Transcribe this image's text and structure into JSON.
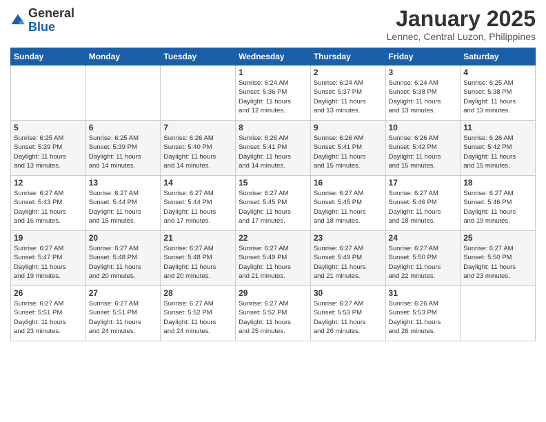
{
  "logo": {
    "general": "General",
    "blue": "Blue"
  },
  "title": "January 2025",
  "location": "Lennec, Central Luzon, Philippines",
  "days_header": [
    "Sunday",
    "Monday",
    "Tuesday",
    "Wednesday",
    "Thursday",
    "Friday",
    "Saturday"
  ],
  "weeks": [
    [
      {
        "day": "",
        "info": ""
      },
      {
        "day": "",
        "info": ""
      },
      {
        "day": "",
        "info": ""
      },
      {
        "day": "1",
        "info": "Sunrise: 6:24 AM\nSunset: 5:36 PM\nDaylight: 11 hours\nand 12 minutes."
      },
      {
        "day": "2",
        "info": "Sunrise: 6:24 AM\nSunset: 5:37 PM\nDaylight: 11 hours\nand 13 minutes."
      },
      {
        "day": "3",
        "info": "Sunrise: 6:24 AM\nSunset: 5:38 PM\nDaylight: 11 hours\nand 13 minutes."
      },
      {
        "day": "4",
        "info": "Sunrise: 6:25 AM\nSunset: 5:38 PM\nDaylight: 11 hours\nand 13 minutes."
      }
    ],
    [
      {
        "day": "5",
        "info": "Sunrise: 6:25 AM\nSunset: 5:39 PM\nDaylight: 11 hours\nand 13 minutes."
      },
      {
        "day": "6",
        "info": "Sunrise: 6:25 AM\nSunset: 5:39 PM\nDaylight: 11 hours\nand 14 minutes."
      },
      {
        "day": "7",
        "info": "Sunrise: 6:26 AM\nSunset: 5:40 PM\nDaylight: 11 hours\nand 14 minutes."
      },
      {
        "day": "8",
        "info": "Sunrise: 6:26 AM\nSunset: 5:41 PM\nDaylight: 11 hours\nand 14 minutes."
      },
      {
        "day": "9",
        "info": "Sunrise: 6:26 AM\nSunset: 5:41 PM\nDaylight: 11 hours\nand 15 minutes."
      },
      {
        "day": "10",
        "info": "Sunrise: 6:26 AM\nSunset: 5:42 PM\nDaylight: 11 hours\nand 15 minutes."
      },
      {
        "day": "11",
        "info": "Sunrise: 6:26 AM\nSunset: 5:42 PM\nDaylight: 11 hours\nand 15 minutes."
      }
    ],
    [
      {
        "day": "12",
        "info": "Sunrise: 6:27 AM\nSunset: 5:43 PM\nDaylight: 11 hours\nand 16 minutes."
      },
      {
        "day": "13",
        "info": "Sunrise: 6:27 AM\nSunset: 5:44 PM\nDaylight: 11 hours\nand 16 minutes."
      },
      {
        "day": "14",
        "info": "Sunrise: 6:27 AM\nSunset: 5:44 PM\nDaylight: 11 hours\nand 17 minutes."
      },
      {
        "day": "15",
        "info": "Sunrise: 6:27 AM\nSunset: 5:45 PM\nDaylight: 11 hours\nand 17 minutes."
      },
      {
        "day": "16",
        "info": "Sunrise: 6:27 AM\nSunset: 5:45 PM\nDaylight: 11 hours\nand 18 minutes."
      },
      {
        "day": "17",
        "info": "Sunrise: 6:27 AM\nSunset: 5:46 PM\nDaylight: 11 hours\nand 18 minutes."
      },
      {
        "day": "18",
        "info": "Sunrise: 6:27 AM\nSunset: 5:46 PM\nDaylight: 11 hours\nand 19 minutes."
      }
    ],
    [
      {
        "day": "19",
        "info": "Sunrise: 6:27 AM\nSunset: 5:47 PM\nDaylight: 11 hours\nand 19 minutes."
      },
      {
        "day": "20",
        "info": "Sunrise: 6:27 AM\nSunset: 5:48 PM\nDaylight: 11 hours\nand 20 minutes."
      },
      {
        "day": "21",
        "info": "Sunrise: 6:27 AM\nSunset: 5:48 PM\nDaylight: 11 hours\nand 20 minutes."
      },
      {
        "day": "22",
        "info": "Sunrise: 6:27 AM\nSunset: 5:49 PM\nDaylight: 11 hours\nand 21 minutes."
      },
      {
        "day": "23",
        "info": "Sunrise: 6:27 AM\nSunset: 5:49 PM\nDaylight: 11 hours\nand 21 minutes."
      },
      {
        "day": "24",
        "info": "Sunrise: 6:27 AM\nSunset: 5:50 PM\nDaylight: 11 hours\nand 22 minutes."
      },
      {
        "day": "25",
        "info": "Sunrise: 6:27 AM\nSunset: 5:50 PM\nDaylight: 11 hours\nand 23 minutes."
      }
    ],
    [
      {
        "day": "26",
        "info": "Sunrise: 6:27 AM\nSunset: 5:51 PM\nDaylight: 11 hours\nand 23 minutes."
      },
      {
        "day": "27",
        "info": "Sunrise: 6:27 AM\nSunset: 5:51 PM\nDaylight: 11 hours\nand 24 minutes."
      },
      {
        "day": "28",
        "info": "Sunrise: 6:27 AM\nSunset: 5:52 PM\nDaylight: 11 hours\nand 24 minutes."
      },
      {
        "day": "29",
        "info": "Sunrise: 6:27 AM\nSunset: 5:52 PM\nDaylight: 11 hours\nand 25 minutes."
      },
      {
        "day": "30",
        "info": "Sunrise: 6:27 AM\nSunset: 5:53 PM\nDaylight: 11 hours\nand 26 minutes."
      },
      {
        "day": "31",
        "info": "Sunrise: 6:26 AM\nSunset: 5:53 PM\nDaylight: 11 hours\nand 26 minutes."
      },
      {
        "day": "",
        "info": ""
      }
    ]
  ]
}
